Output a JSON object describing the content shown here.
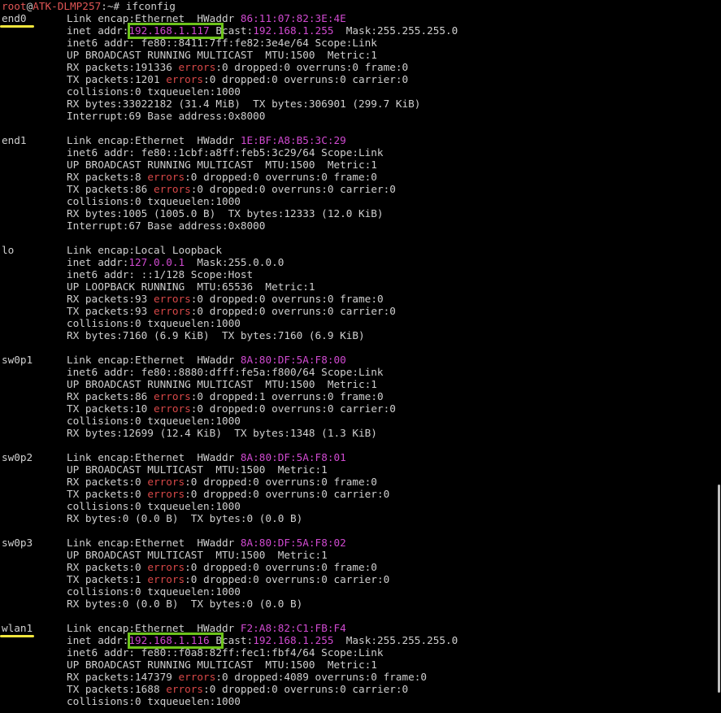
{
  "prompt": {
    "user": "root",
    "at": "@",
    "host": "ATK-DLMP257",
    "path": ":~# ",
    "command": "ifconfig"
  },
  "colors": {
    "background": "#000000",
    "text": "#cfcfcf",
    "magenta": "#d04ad0",
    "error_red": "#d84848",
    "highlight_box": "#6cc31a",
    "underline": "#f1e63c"
  },
  "interfaces": [
    {
      "name": "end0",
      "link": "Link encap:Ethernet  HWaddr ",
      "hwaddr": "86:11:07:82:3E:4E",
      "inet_prefix": "inet addr:",
      "inet_addr": "192.168.1.117",
      "bcast_label": " Bcast:",
      "bcast": "192.168.1.255",
      "mask": "  Mask:255.255.255.0",
      "inet6": "inet6 addr: fe80::8411:7ff:fe82:3e4e/64 Scope:Link",
      "flags": "UP BROADCAST RUNNING MULTICAST  MTU:1500  Metric:1",
      "rx_packets": "RX packets:191336 ",
      "rx_err": "errors",
      "rx_rest": ":0 dropped:0 overruns:0 frame:0",
      "tx_packets": "TX packets:1201 ",
      "tx_err": "errors",
      "tx_rest": ":0 dropped:0 overruns:0 carrier:0",
      "collisions": "collisions:0 txqueuelen:1000",
      "bytes": "RX bytes:33022182 (31.4 MiB)  TX bytes:306901 (299.7 KiB)",
      "interrupt": "Interrupt:69 Base address:0x8000"
    },
    {
      "name": "end1",
      "link": "Link encap:Ethernet  HWaddr ",
      "hwaddr": "1E:BF:A8:B5:3C:29",
      "inet6": "inet6 addr: fe80::1cbf:a8ff:feb5:3c29/64 Scope:Link",
      "flags": "UP BROADCAST RUNNING MULTICAST  MTU:1500  Metric:1",
      "rx_packets": "RX packets:8 ",
      "rx_err": "errors",
      "rx_rest": ":0 dropped:0 overruns:0 frame:0",
      "tx_packets": "TX packets:86 ",
      "tx_err": "errors",
      "tx_rest": ":0 dropped:0 overruns:0 carrier:0",
      "collisions": "collisions:0 txqueuelen:1000",
      "bytes": "RX bytes:1005 (1005.0 B)  TX bytes:12333 (12.0 KiB)",
      "interrupt": "Interrupt:67 Base address:0x8000"
    },
    {
      "name": "lo",
      "link": "Link encap:Local Loopback",
      "inet_prefix": "inet addr:",
      "inet_addr": "127.0.0.1",
      "mask": "  Mask:255.0.0.0",
      "inet6": "inet6 addr: ::1/128 Scope:Host",
      "flags": "UP LOOPBACK RUNNING  MTU:65536  Metric:1",
      "rx_packets": "RX packets:93 ",
      "rx_err": "errors",
      "rx_rest": ":0 dropped:0 overruns:0 frame:0",
      "tx_packets": "TX packets:93 ",
      "tx_err": "errors",
      "tx_rest": ":0 dropped:0 overruns:0 carrier:0",
      "collisions": "collisions:0 txqueuelen:1000",
      "bytes": "RX bytes:7160 (6.9 KiB)  TX bytes:7160 (6.9 KiB)"
    },
    {
      "name": "sw0p1",
      "link": "Link encap:Ethernet  HWaddr ",
      "hwaddr": "8A:80:DF:5A:F8:00",
      "inet6": "inet6 addr: fe80::8880:dfff:fe5a:f800/64 Scope:Link",
      "flags": "UP BROADCAST RUNNING MULTICAST  MTU:1500  Metric:1",
      "rx_packets": "RX packets:86 ",
      "rx_err": "errors",
      "rx_rest": ":0 dropped:1 overruns:0 frame:0",
      "tx_packets": "TX packets:10 ",
      "tx_err": "errors",
      "tx_rest": ":0 dropped:0 overruns:0 carrier:0",
      "collisions": "collisions:0 txqueuelen:1000",
      "bytes": "RX bytes:12699 (12.4 KiB)  TX bytes:1348 (1.3 KiB)"
    },
    {
      "name": "sw0p2",
      "link": "Link encap:Ethernet  HWaddr ",
      "hwaddr": "8A:80:DF:5A:F8:01",
      "flags": "UP BROADCAST MULTICAST  MTU:1500  Metric:1",
      "rx_packets": "RX packets:0 ",
      "rx_err": "errors",
      "rx_rest": ":0 dropped:0 overruns:0 frame:0",
      "tx_packets": "TX packets:0 ",
      "tx_err": "errors",
      "tx_rest": ":0 dropped:0 overruns:0 carrier:0",
      "collisions": "collisions:0 txqueuelen:1000",
      "bytes": "RX bytes:0 (0.0 B)  TX bytes:0 (0.0 B)"
    },
    {
      "name": "sw0p3",
      "link": "Link encap:Ethernet  HWaddr ",
      "hwaddr": "8A:80:DF:5A:F8:02",
      "flags": "UP BROADCAST MULTICAST  MTU:1500  Metric:1",
      "rx_packets": "RX packets:0 ",
      "rx_err": "errors",
      "rx_rest": ":0 dropped:0 overruns:0 frame:0",
      "tx_packets": "TX packets:1 ",
      "tx_err": "errors",
      "tx_rest": ":0 dropped:0 overruns:0 carrier:0",
      "collisions": "collisions:0 txqueuelen:1000",
      "bytes": "RX bytes:0 (0.0 B)  TX bytes:0 (0.0 B)"
    },
    {
      "name": "wlan1",
      "link": "Link encap:Ethernet  HWaddr ",
      "hwaddr": "F2:A8:82:C1:FB:F4",
      "inet_prefix": "inet addr:",
      "inet_addr": "192.168.1.116",
      "bcast_label": " Bcast:",
      "bcast": "192.168.1.255",
      "mask": "  Mask:255.255.255.0",
      "inet6": "inet6 addr: fe80::f0a8:82ff:fec1:fbf4/64 Scope:Link",
      "flags": "UP BROADCAST RUNNING MULTICAST  MTU:1500  Metric:1",
      "rx_packets": "RX packets:147379 ",
      "rx_err": "errors",
      "rx_rest": ":0 dropped:4089 overruns:0 frame:0",
      "tx_packets": "TX packets:1688 ",
      "tx_err": "errors",
      "tx_rest": ":0 dropped:0 overruns:0 carrier:0",
      "collisions": "collisions:0 txqueuelen:1000"
    }
  ]
}
